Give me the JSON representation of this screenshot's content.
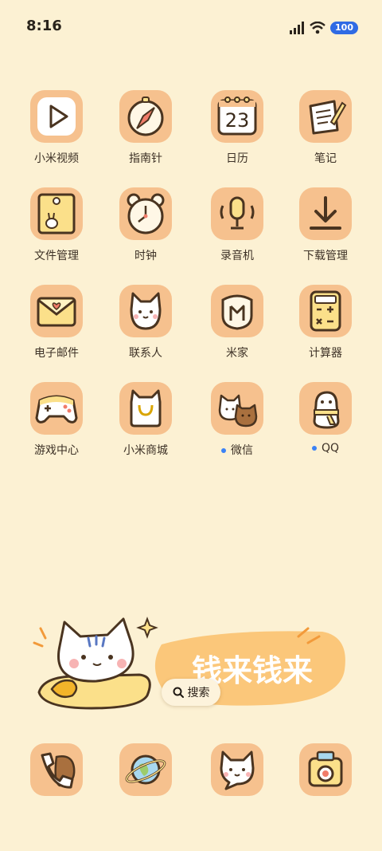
{
  "status_bar": {
    "time": "8:16",
    "battery": "100"
  },
  "apps": [
    {
      "id": "mi-video",
      "label": "小米视频",
      "icon": "play-icon"
    },
    {
      "id": "compass",
      "label": "指南针",
      "icon": "compass-icon"
    },
    {
      "id": "calendar",
      "label": "日历",
      "icon": "calendar-icon",
      "calendar_day": "23"
    },
    {
      "id": "notes",
      "label": "笔记",
      "icon": "notes-icon"
    },
    {
      "id": "file-manager",
      "label": "文件管理",
      "icon": "folder-icon"
    },
    {
      "id": "clock",
      "label": "时钟",
      "icon": "clock-icon"
    },
    {
      "id": "recorder",
      "label": "录音机",
      "icon": "microphone-icon"
    },
    {
      "id": "downloads",
      "label": "下载管理",
      "icon": "download-icon"
    },
    {
      "id": "email",
      "label": "电子邮件",
      "icon": "envelope-icon"
    },
    {
      "id": "contacts",
      "label": "联系人",
      "icon": "cat-contact-icon"
    },
    {
      "id": "mi-home",
      "label": "米家",
      "icon": "mi-home-icon"
    },
    {
      "id": "calculator",
      "label": "计算器",
      "icon": "calculator-icon"
    },
    {
      "id": "game-center",
      "label": "游戏中心",
      "icon": "gamepad-icon"
    },
    {
      "id": "mi-store",
      "label": "小米商城",
      "icon": "shopping-bag-icon"
    },
    {
      "id": "wechat",
      "label": "微信",
      "icon": "wechat-cats-icon",
      "new_dot": true
    },
    {
      "id": "qq",
      "label": "QQ",
      "icon": "penguin-icon",
      "new_dot": true
    }
  ],
  "widget": {
    "banner_text": "钱来钱来",
    "search_label": "搜索"
  },
  "dock": [
    {
      "id": "phone",
      "icon": "phone-icon"
    },
    {
      "id": "browser",
      "icon": "planet-icon"
    },
    {
      "id": "messages",
      "icon": "cat-message-icon"
    },
    {
      "id": "camera",
      "icon": "camera-icon"
    }
  ],
  "colors": {
    "background": "#fcf1d3",
    "tile": "#f6c18e",
    "outline": "#4a3420",
    "accent_yellow": "#fbe08a",
    "dot_blue": "#3b82f6"
  }
}
